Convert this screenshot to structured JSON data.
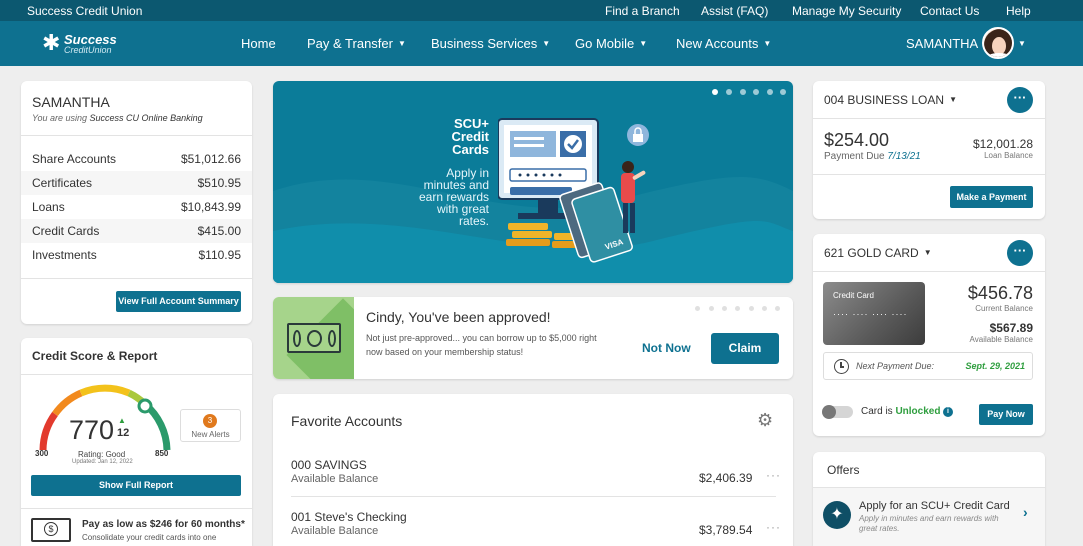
{
  "topbar": {
    "brand": "Success Credit Union",
    "links": [
      "Find a Branch",
      "Assist (FAQ)",
      "Manage My Security",
      "Contact Us",
      "Help"
    ]
  },
  "navbar": {
    "logo_line1": "Success",
    "logo_line2": "CreditUnion",
    "items": [
      "Home",
      "Pay & Transfer",
      "Business Services",
      "Go Mobile",
      "New Accounts"
    ],
    "user": "SAMANTHA"
  },
  "summary": {
    "name": "SAMANTHA",
    "using_prefix": "You are using ",
    "using_bold": "Success CU Online Banking",
    "rows": [
      {
        "label": "Share Accounts",
        "value": "$51,012.66"
      },
      {
        "label": "Certificates",
        "value": "$510.95"
      },
      {
        "label": "Loans",
        "value": "$10,843.99"
      },
      {
        "label": "Credit Cards",
        "value": "$415.00"
      },
      {
        "label": "Investments",
        "value": "$110.95"
      }
    ],
    "button": "View Full Account Summary"
  },
  "credit": {
    "title": "Credit Score & Report",
    "score": "770",
    "change": "12",
    "rating": "Rating: Good",
    "updated": "Updated: Jan 12, 2022",
    "min": "300",
    "max": "850",
    "alerts_count": "3",
    "alerts_label": "New Alerts",
    "button": "Show Full Report",
    "promo_title": "Pay as low as $246 for 60 months*",
    "promo_text": "Consolidate your credit cards into one"
  },
  "banner": {
    "title_line1": "SCU+",
    "title_line2": "Credit",
    "title_line3": "Cards",
    "sub1": "Apply in",
    "sub2": "minutes and",
    "sub3": "earn rewards",
    "sub4": "with great",
    "sub5": "rates.",
    "card_text": "VISA"
  },
  "approval": {
    "title": "Cindy, You've been approved!",
    "text1": "Not just pre-approved... you can borrow up to $5,000 right",
    "text2": "now based on your membership status!",
    "not_now": "Not Now",
    "claim": "Claim"
  },
  "favorites": {
    "title": "Favorite Accounts",
    "items": [
      {
        "name": "000 SAVINGS",
        "sub": "Available Balance",
        "value": "$2,406.39"
      },
      {
        "name": "001 Steve's Checking",
        "sub": "Available Balance",
        "value": "$3,789.54"
      }
    ]
  },
  "loan": {
    "title": "004 BUSINESS LOAN",
    "amount": "$254.00",
    "due_label": "Payment Due ",
    "due_date": "7/13/21",
    "balance": "$12,001.28",
    "balance_label": "Loan Balance",
    "button": "Make a Payment"
  },
  "gold": {
    "title": "621 GOLD CARD",
    "card_label": "Credit Card",
    "card_number": "···· ···· ···· ····",
    "current": "$456.78",
    "current_label": "Current Balance",
    "available": "$567.89",
    "available_label": "Available Balance",
    "next_label": "Next Payment Due:",
    "next_date": "Sept. 29, 2021",
    "status_prefix": "Card is ",
    "status_value": "Unlocked",
    "button": "Pay Now"
  },
  "offers": {
    "title": "Offers",
    "item_title": "Apply for an SCU+ Credit Card",
    "item_line1": "Apply in minutes and earn rewards with",
    "item_line2": "great rates."
  },
  "colors": {
    "brand": "#0e7190",
    "topbar": "#0c5870",
    "green": "#2e9e3e"
  }
}
